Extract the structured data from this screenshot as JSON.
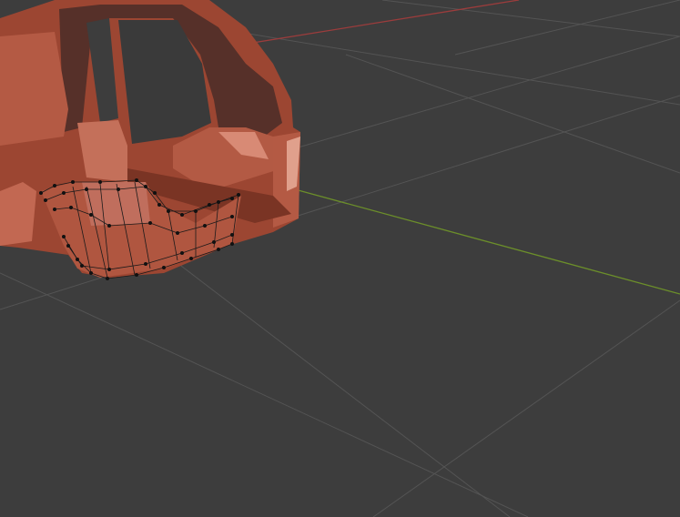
{
  "viewport": {
    "background": "#3d3d3d",
    "grid_color": "#555555",
    "x_axis_color": "#9b3c3c",
    "y_axis_color": "#6c8f2a",
    "mesh_color": "#a8503a",
    "mesh_highlight": "#d98a75",
    "vertex_color": "#111111"
  }
}
